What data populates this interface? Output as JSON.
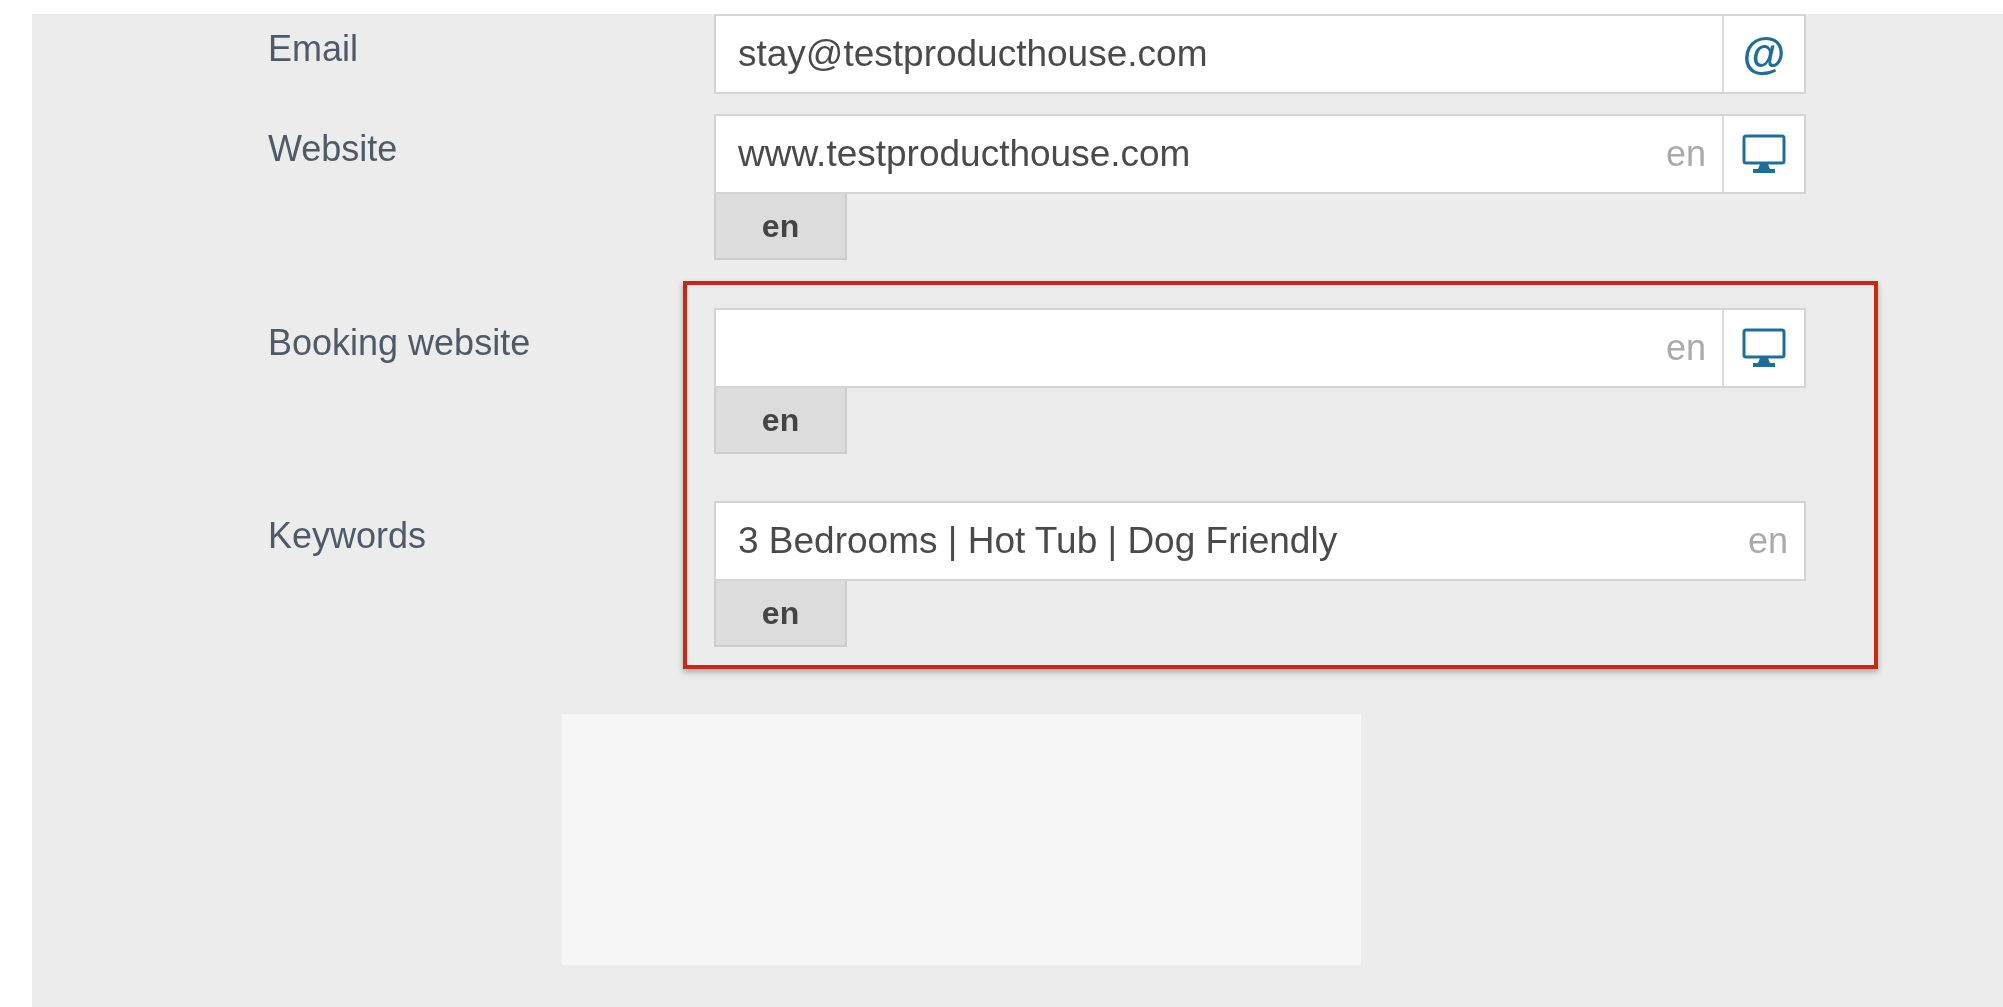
{
  "fields": [
    {
      "label": "Email",
      "value": "stay@testproducthouse.com",
      "icon": {
        "kind": "glyph",
        "text": "@"
      },
      "highlighted": false
    },
    {
      "label": "Website",
      "value": "www.testproducthouse.com",
      "hint": "en",
      "icon": {
        "kind": "monitor"
      },
      "lang_tab": "en",
      "highlighted": false
    },
    {
      "label": "Booking website",
      "hint": "en",
      "icon": {
        "kind": "monitor"
      },
      "lang_tab": "en",
      "highlighted": true
    },
    {
      "label": "Keywords",
      "value": "3 Bedrooms | Hot Tub | Dog Friendly",
      "hint": "en",
      "lang_tab": "en",
      "highlighted": true
    }
  ]
}
